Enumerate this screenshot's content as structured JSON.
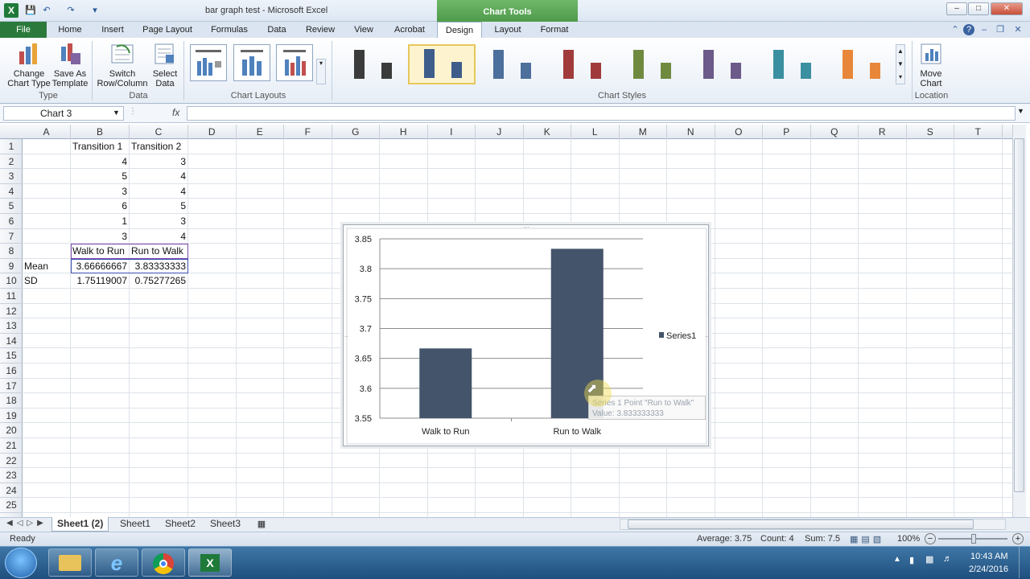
{
  "window": {
    "title": "bar graph test - Microsoft Excel",
    "context_group": "Chart Tools",
    "buttons": {
      "minimize": "–",
      "maximize": "□",
      "close": "✕"
    }
  },
  "tabs": [
    "Home",
    "Insert",
    "Page Layout",
    "Formulas",
    "Data",
    "Review",
    "View",
    "Acrobat",
    "Design",
    "Layout",
    "Format"
  ],
  "file_tab": "File",
  "active_tab": "Design",
  "ribbon": {
    "type_group": {
      "label": "Type",
      "change_chart_type": "Change Chart Type",
      "save_as_template": "Save As Template"
    },
    "data_group": {
      "label": "Data",
      "switch": "Switch Row/Column",
      "select": "Select Data"
    },
    "layouts_group": {
      "label": "Chart Layouts"
    },
    "styles_group": {
      "label": "Chart Styles"
    },
    "location_group": {
      "label": "Location",
      "move": "Move Chart"
    },
    "style_colors": [
      "#3b3b3b",
      "#3e5d8a",
      "#4c6f9c",
      "#a13a3a",
      "#6f8a3f",
      "#6b5a8a",
      "#3a8fa0",
      "#e8873a"
    ]
  },
  "formula_bar": {
    "name_box": "Chart 3",
    "fx": "fx",
    "value": ""
  },
  "columns": [
    "A",
    "B",
    "C",
    "D",
    "E",
    "F",
    "G",
    "H",
    "I",
    "J",
    "K",
    "L",
    "M",
    "N",
    "O",
    "P",
    "Q",
    "R",
    "S",
    "T"
  ],
  "rows": [
    "1",
    "2",
    "3",
    "4",
    "5",
    "6",
    "7",
    "8",
    "9",
    "10",
    "11",
    "12",
    "13",
    "14",
    "15",
    "16",
    "17",
    "18",
    "19",
    "20",
    "21",
    "22",
    "23",
    "24",
    "25"
  ],
  "cells": [
    {
      "ref": "B1",
      "v": "Transition 1"
    },
    {
      "ref": "C1",
      "v": "Transition 2"
    },
    {
      "ref": "B2",
      "v": "4"
    },
    {
      "ref": "C2",
      "v": "3"
    },
    {
      "ref": "B3",
      "v": "5"
    },
    {
      "ref": "C3",
      "v": "4"
    },
    {
      "ref": "B4",
      "v": "3"
    },
    {
      "ref": "C4",
      "v": "4"
    },
    {
      "ref": "B5",
      "v": "6"
    },
    {
      "ref": "C5",
      "v": "5"
    },
    {
      "ref": "B6",
      "v": "1"
    },
    {
      "ref": "C6",
      "v": "3"
    },
    {
      "ref": "B7",
      "v": "3"
    },
    {
      "ref": "C7",
      "v": "4"
    },
    {
      "ref": "B8",
      "v": "Walk to Run"
    },
    {
      "ref": "C8",
      "v": "Run to Walk"
    },
    {
      "ref": "A9",
      "v": "Mean"
    },
    {
      "ref": "B9",
      "v": "3.66666667"
    },
    {
      "ref": "C9",
      "v": "3.83333333"
    },
    {
      "ref": "A10",
      "v": "SD"
    },
    {
      "ref": "B10",
      "v": "1.75119007"
    },
    {
      "ref": "C10",
      "v": "0.75277265"
    }
  ],
  "chart_data": {
    "type": "bar",
    "categories": [
      "Walk to Run",
      "Run to Walk"
    ],
    "series": [
      {
        "name": "Series1",
        "values": [
          3.66666667,
          3.83333333
        ],
        "color": "#44546a"
      }
    ],
    "ylim": [
      3.55,
      3.85
    ],
    "yticks": [
      "3.55",
      "3.6",
      "3.65",
      "3.7",
      "3.75",
      "3.8",
      "3.85"
    ],
    "grid": true,
    "legend": "right",
    "tooltip": {
      "line1": "Series 1 Point \"Run to Walk\"",
      "line2": "Value: 3.833333333"
    }
  },
  "sheet_tabs": [
    "Sheet1 (2)",
    "Sheet1",
    "Sheet2",
    "Sheet3"
  ],
  "status": {
    "ready": "Ready",
    "average": "Average: 3.75",
    "count": "Count: 4",
    "sum": "Sum: 7.5",
    "zoom": "100%"
  },
  "taskbar": {
    "time": "10:43 AM",
    "date": "2/24/2016"
  }
}
